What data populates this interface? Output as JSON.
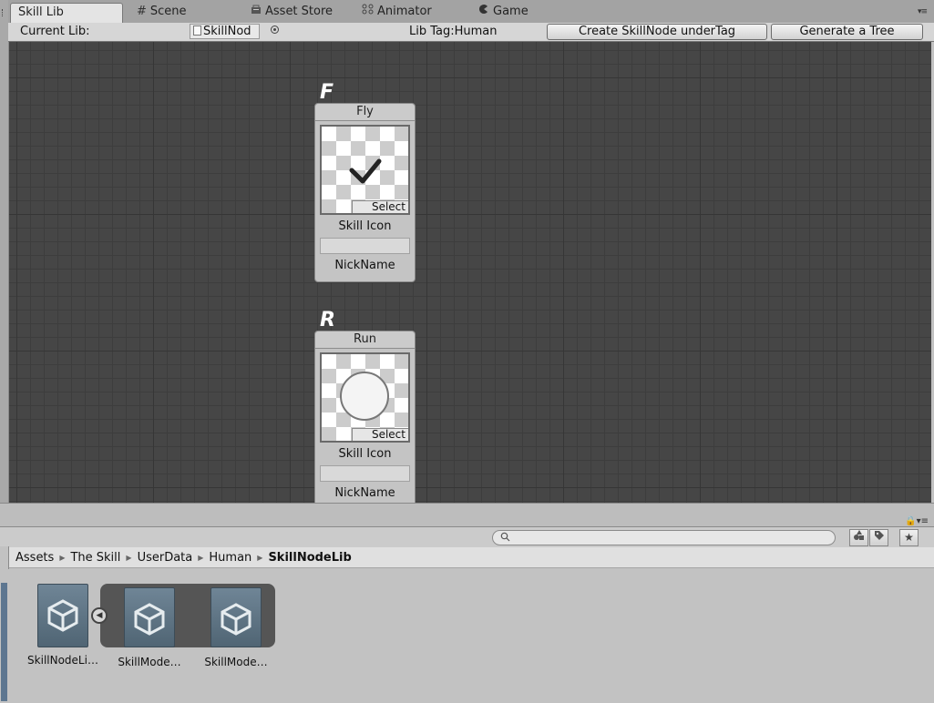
{
  "tabs": [
    {
      "label": "Skill Lib",
      "icon": "",
      "active": true
    },
    {
      "label": "Scene",
      "icon": "#"
    },
    {
      "label": "Asset Store",
      "icon": "store-icon"
    },
    {
      "label": "Animator",
      "icon": "animator-icon"
    },
    {
      "label": "Game",
      "icon": "game-icon"
    }
  ],
  "toolbar": {
    "current_lib_label": "Current Lib:",
    "current_lib_value": "SkillNod",
    "lib_tag": "Lib Tag:Human",
    "create_button": "Create SkillNode underTag",
    "generate_button": "Generate a Tree"
  },
  "nodes": [
    {
      "letter": "F",
      "title": "Fly",
      "icon": "checkmark-icon",
      "select_label": "Select",
      "icon_label": "Skill Icon",
      "nick_label": "NickName",
      "nick_value": ""
    },
    {
      "letter": "R",
      "title": "Run",
      "icon": "circle-icon",
      "select_label": "Select",
      "icon_label": "Skill Icon",
      "nick_label": "NickName",
      "nick_value": ""
    }
  ],
  "project": {
    "search_placeholder": "",
    "breadcrumb": [
      "Assets",
      "The Skill",
      "UserData",
      "Human",
      "SkillNodeLib"
    ],
    "assets": [
      {
        "name": "SkillNodeLi…"
      },
      {
        "name": "SkillMode…"
      },
      {
        "name": "SkillMode…"
      }
    ]
  },
  "colors": {
    "canvas": "#464646",
    "panel": "#c2c2c2",
    "asset_thumb": "#5f7585"
  }
}
